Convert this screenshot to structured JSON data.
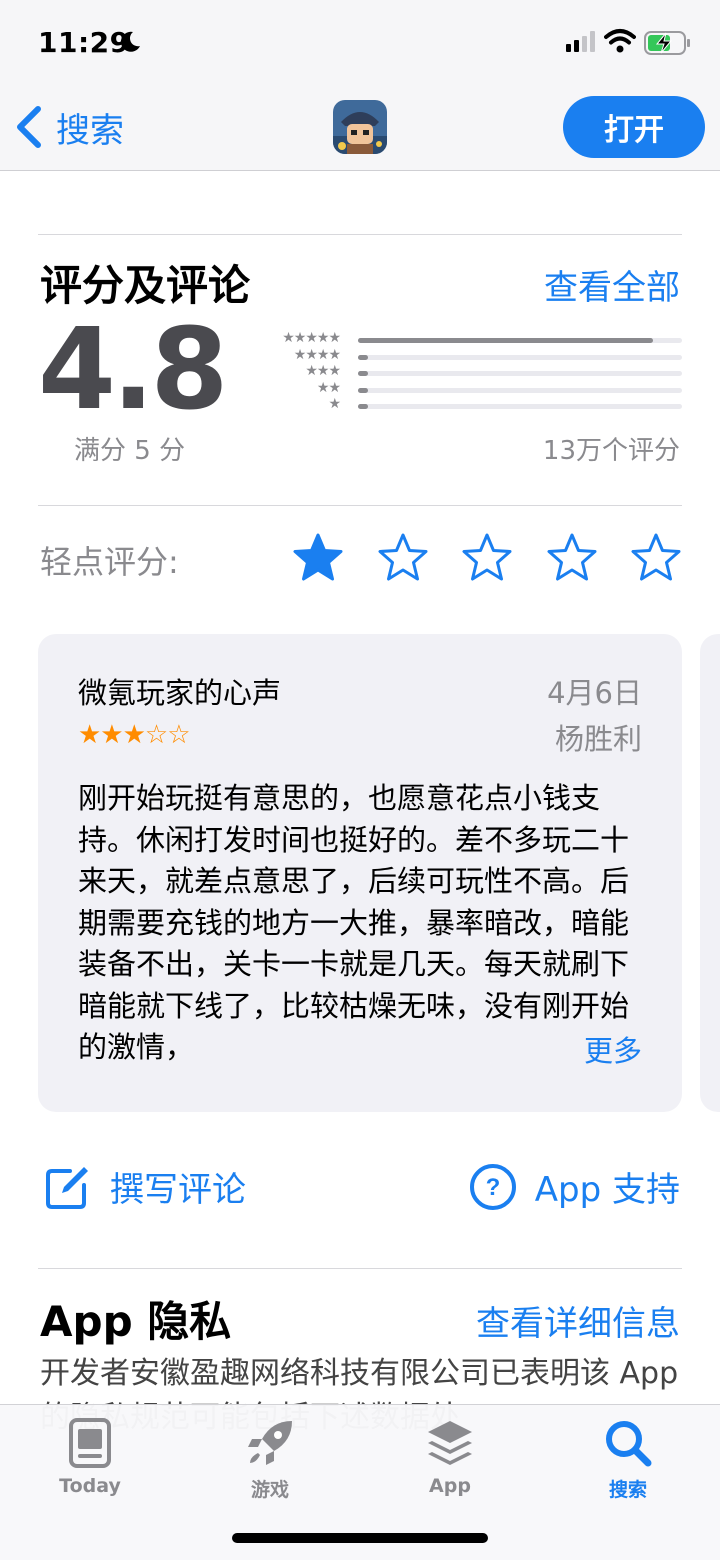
{
  "status": {
    "time": "11:29"
  },
  "nav": {
    "back_label": "搜索",
    "open_label": "打开"
  },
  "ratings": {
    "title": "评分及评论",
    "see_all": "查看全部",
    "average": "4.8",
    "out_of": "满分 5 分",
    "count": "13万个评分",
    "distribution": [
      {
        "stars": "★★★★★",
        "fraction": 0.91
      },
      {
        "stars": "★★★★",
        "fraction": 0.03
      },
      {
        "stars": "★★★",
        "fraction": 0.005
      },
      {
        "stars": "★★",
        "fraction": 0.005
      },
      {
        "stars": "★",
        "fraction": 0.03
      }
    ]
  },
  "tap_to_rate": {
    "label": "轻点评分:",
    "selected": 1,
    "total": 5
  },
  "review": {
    "title": "微氪玩家的心声",
    "date": "4月6日",
    "author": "杨胜利",
    "stars": "★★★☆☆",
    "rating": 3,
    "body": "刚开始玩挺有意思的，也愿意花点小钱支持。休闲打发时间也挺好的。差不多玩二十来天，就差点意思了，后续可玩性不高。后期需要充钱的地方一大推，暴率暗改，暗能装备不出，关卡一卡就是几天。每天就刷下暗能就下线了，比较枯燥无味，没有刚开始的激情，",
    "more": "更多"
  },
  "actions": {
    "write_review": "撰写评论",
    "app_support": "App 支持"
  },
  "privacy": {
    "title": "App 隐私",
    "link": "查看详细信息",
    "text": "开发者安徽盈趣网络科技有限公司已表明该 App 的隐私规范可能包括下述数据处"
  },
  "tabs": [
    {
      "label": "Today",
      "icon": "today-icon"
    },
    {
      "label": "游戏",
      "icon": "games-rocket-icon"
    },
    {
      "label": "App",
      "icon": "apps-stack-icon"
    },
    {
      "label": "搜索",
      "icon": "search-icon",
      "active": true
    }
  ],
  "colors": {
    "accent": "#1a7ff0",
    "review_star": "#ff8c00",
    "secondary_text": "#8a8a8e"
  }
}
